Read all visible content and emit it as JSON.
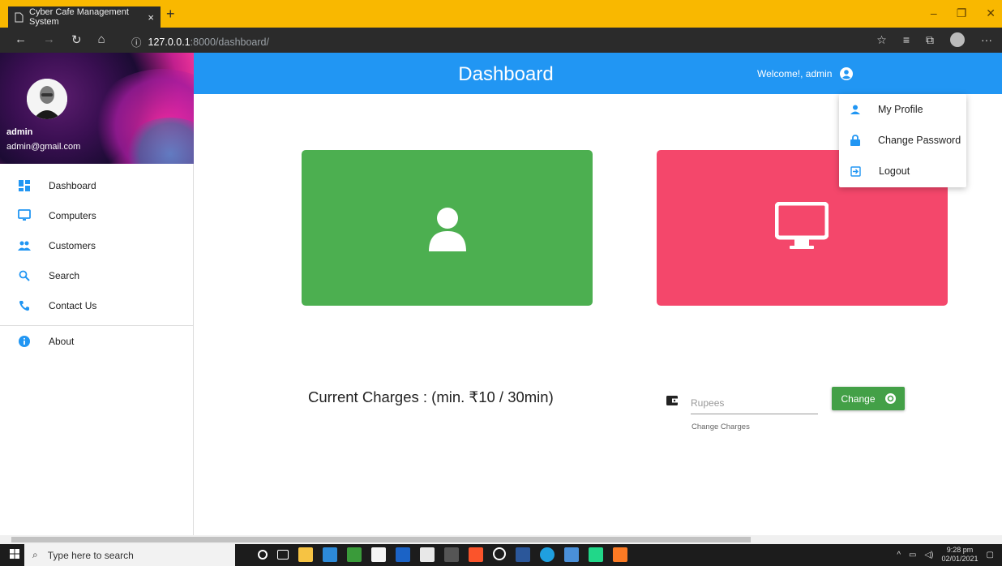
{
  "browser": {
    "tab_title": "Cyber Cafe Management System",
    "tab_close": "×",
    "new_tab": "+",
    "url_host": "127.0.0.1",
    "url_path": ":8000/dashboard/",
    "window_controls": [
      "–",
      "❐",
      "✕"
    ]
  },
  "sidebar": {
    "user_name": "admin",
    "user_email": "admin@gmail.com",
    "items": [
      {
        "label": "Dashboard",
        "icon": "dashboard-icon",
        "color": "#2196f3"
      },
      {
        "label": "Computers",
        "icon": "monitor-icon",
        "color": "#2196f3"
      },
      {
        "label": "Customers",
        "icon": "people-icon",
        "color": "#2196f3"
      },
      {
        "label": "Search",
        "icon": "search-icon",
        "color": "#2196f3"
      },
      {
        "label": "Contact Us",
        "icon": "phone-icon",
        "color": "#2196f3"
      },
      {
        "label": "About",
        "icon": "info-icon",
        "color": "#2196f3"
      }
    ]
  },
  "header": {
    "title": "Dashboard",
    "welcome": "Welcome!, admin",
    "color": "#2196f3"
  },
  "dropdown": {
    "items": [
      {
        "label": "My Profile",
        "icon": "person-icon"
      },
      {
        "label": "Change Password",
        "icon": "lock-icon"
      },
      {
        "label": "Logout",
        "icon": "logout-icon"
      }
    ]
  },
  "cards": {
    "customers_color": "#4caf50",
    "computers_color": "#f4476b"
  },
  "charges": {
    "label": "Current Charges : (min. ₹10 / 30min)",
    "input_placeholder": "Rupees",
    "caption": "Change Charges",
    "button_label": "Change"
  },
  "taskbar": {
    "search_placeholder": "Type here to search",
    "time": "9:28 pm",
    "date": "02/01/2021"
  }
}
